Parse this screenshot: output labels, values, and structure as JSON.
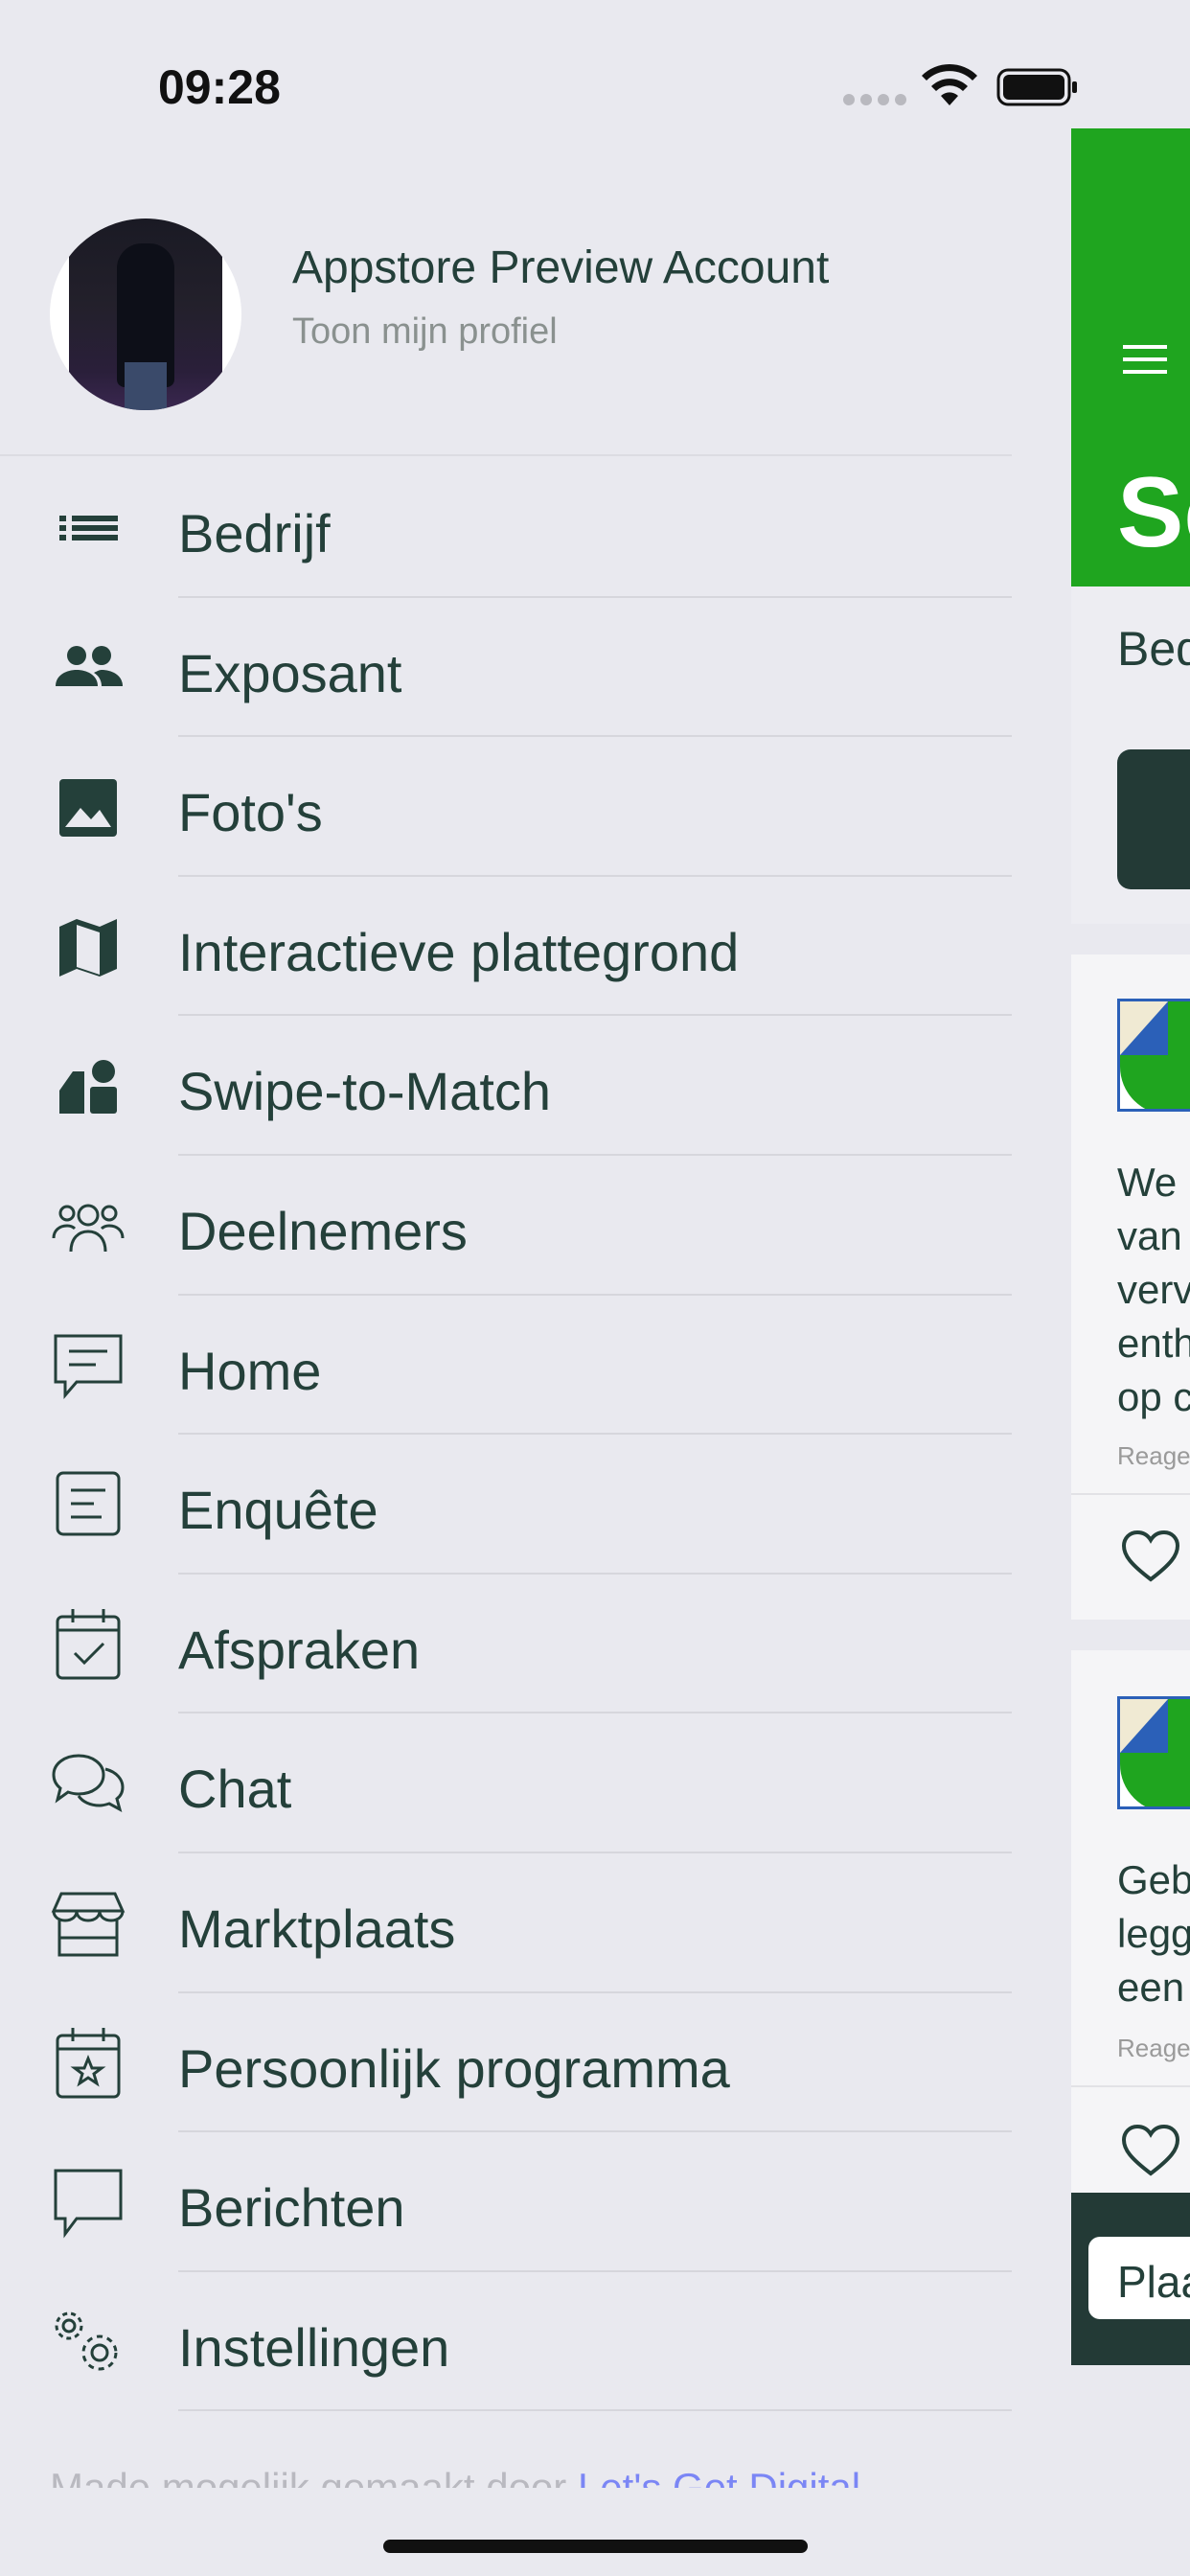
{
  "status_bar": {
    "time": "09:28"
  },
  "profile": {
    "name": "Appstore Preview Account",
    "subtitle": "Toon mijn profiel"
  },
  "menu": [
    {
      "label": "Bedrijf",
      "icon": "list-icon"
    },
    {
      "label": "Exposant",
      "icon": "people-icon"
    },
    {
      "label": "Foto's",
      "icon": "image-icon"
    },
    {
      "label": "Interactieve plattegrond",
      "icon": "map-icon"
    },
    {
      "label": "Swipe-to-Match",
      "icon": "shapes-icon"
    },
    {
      "label": "Deelnemers",
      "icon": "participants-icon"
    },
    {
      "label": "Home",
      "icon": "message-square-icon"
    },
    {
      "label": "Enquête",
      "icon": "document-icon"
    },
    {
      "label": "Afspraken",
      "icon": "calendar-check-icon"
    },
    {
      "label": "Chat",
      "icon": "chat-bubbles-icon"
    },
    {
      "label": "Marktplaats",
      "icon": "storefront-icon"
    },
    {
      "label": "Persoonlijk programma",
      "icon": "calendar-star-icon"
    },
    {
      "label": "Berichten",
      "icon": "message-icon"
    },
    {
      "label": "Instellingen",
      "icon": "settings-gears-icon"
    }
  ],
  "footer": {
    "text": "Made mogelijk gemaakt door ",
    "link": "Let's Get Digital"
  },
  "background": {
    "title": "Se",
    "tab": "Bed",
    "cards": [
      {
        "text_lines": [
          "We",
          "van",
          "verv",
          "enth",
          "op c"
        ],
        "meta": "Reage"
      },
      {
        "text_lines": [
          "Geb",
          "legg",
          "een"
        ],
        "meta": "Reage"
      }
    ],
    "bottom_button": "Plaa"
  },
  "colors": {
    "accent_green": "#1fa51f",
    "dark": "#233a36",
    "text": "#24403a",
    "link": "#7b86f5"
  }
}
